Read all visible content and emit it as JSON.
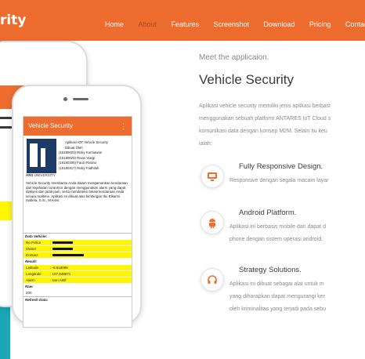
{
  "navbar": {
    "brand": "rity",
    "items": [
      "Home",
      "About",
      "Features",
      "Screenshot",
      "Download",
      "Pricing",
      "Contac"
    ],
    "active_index": 1
  },
  "colors": {
    "accent": "#ef6c2f",
    "teal": "#1aa8b6",
    "highlight": "#fff600"
  },
  "phone_screen": {
    "app_title": "Vehicle Security",
    "menu_icon": "overflow-menu-icon",
    "credits": [
      "Aplikasi IOT Vehicle Security",
      "Dibuat Oleh",
      "(16180001) Risky Kurniawan",
      "(16180029) Risan Viargi",
      "(16180305) Fauzi Rivano",
      "(16180317) Risky Fadhilah"
    ],
    "logo_text": "ARS",
    "logo_subtext": "UNIVERSITY",
    "description": "Vehicle Security membantu Anda dalam mengamankan kendaraan dari kejahatan curanmor dengan menggunakan alarm yang dapat diakses dari jarak jauh, serta mendeteksi lokasi kendaraan Anda secara realtime. Aplikasi ini dibuat atas bimbingan Ibu Elkarini Isabela, S.Si., M.Kom.",
    "data_vehicle_header": "Data Vehicle:",
    "data_vehicle": [
      {
        "key": "No Police",
        "value": ":"
      },
      {
        "key": "Owner",
        "value": ":"
      },
      {
        "key": "Contact",
        "value": ":"
      }
    ],
    "result_header": "Result:",
    "result": [
      {
        "key": "Latitude",
        "value": ": -6.918095"
      },
      {
        "key": "Longitude",
        "value": ": 107.649571"
      },
      {
        "key": "Alarm",
        "value": ": Non Aktif"
      }
    ],
    "raw_header": "Raw:",
    "raw_value": "200",
    "refresh_header": "Refresh Data:"
  },
  "content": {
    "meet": "Meet the applicaion.",
    "title": "Vehicle Security",
    "intro_lines": [
      "Aplikasi vehicle security memiliki jenis aplikasi berbasi",
      "menggunakan sebuah platform ANTARES IoT Cloud s",
      "komunikasi data dengan konsep M2M. Selain itu keu",
      "ialah:"
    ],
    "features": [
      {
        "icon": "desktop-icon",
        "title": "Fully Responsive Design.",
        "desc_lines": [
          "Responsive dengan segala macam layar"
        ]
      },
      {
        "icon": "android-icon",
        "title": "Android Platform.",
        "desc_lines": [
          "Aplikasi ini berbasis mobile dan dapat d",
          "phone dengan sistem operasi android."
        ]
      },
      {
        "icon": "headset-icon",
        "title": "Strategy Solutions.",
        "desc_lines": [
          "Aplikasi ini dibuat sebagai alat untuk m",
          "yang diharapkan dapat mengurangi ker",
          "oleh kriminalitas yang terjadi pada sebu"
        ]
      }
    ]
  }
}
